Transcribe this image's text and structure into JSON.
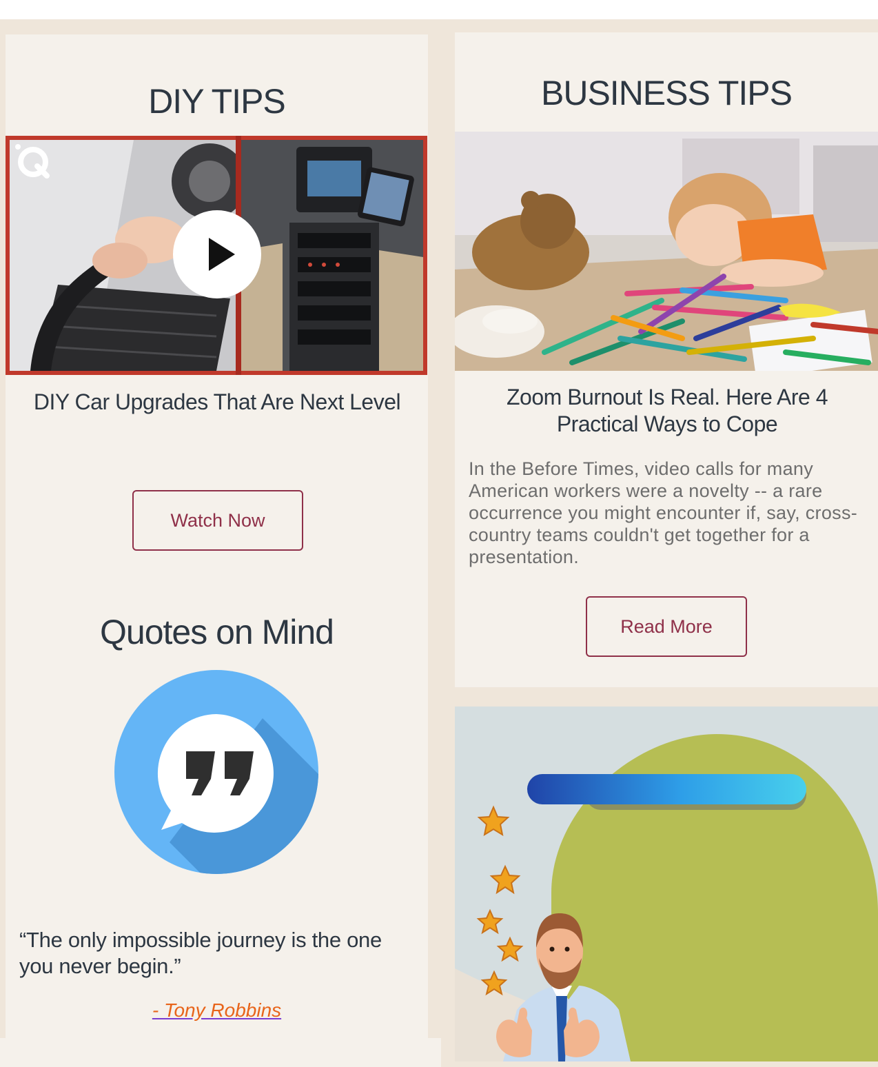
{
  "diy": {
    "heading": "DIY TIPS",
    "article_title": "DIY Car Upgrades That Are Next Level",
    "button_label": "Watch Now"
  },
  "business": {
    "heading": "BUSINESS TIPS",
    "article_title": "Zoom Burnout Is Real. Here Are 4 Practical Ways to Cope",
    "excerpt": "In the Before Times, video calls for many American workers were a novelty -- a rare occurrence you might encounter if, say, cross-country teams couldn't get together for a presentation.",
    "button_label": "Read More"
  },
  "quotes": {
    "heading": "Quotes on Mind",
    "quote": "“The only impossible journey is the one you never begin.”",
    "author": "- Tony Robbins"
  },
  "colors": {
    "heading_text": "#2d3742",
    "button_accent": "#8f3049",
    "author_link": "#e8641a",
    "page_band": "#efe6da",
    "card_bg": "#f5f1eb"
  },
  "icons": {
    "video_play": "play-icon",
    "quote_bubble": "quote-bubble-icon",
    "brand_logo": "q-logo-icon"
  }
}
